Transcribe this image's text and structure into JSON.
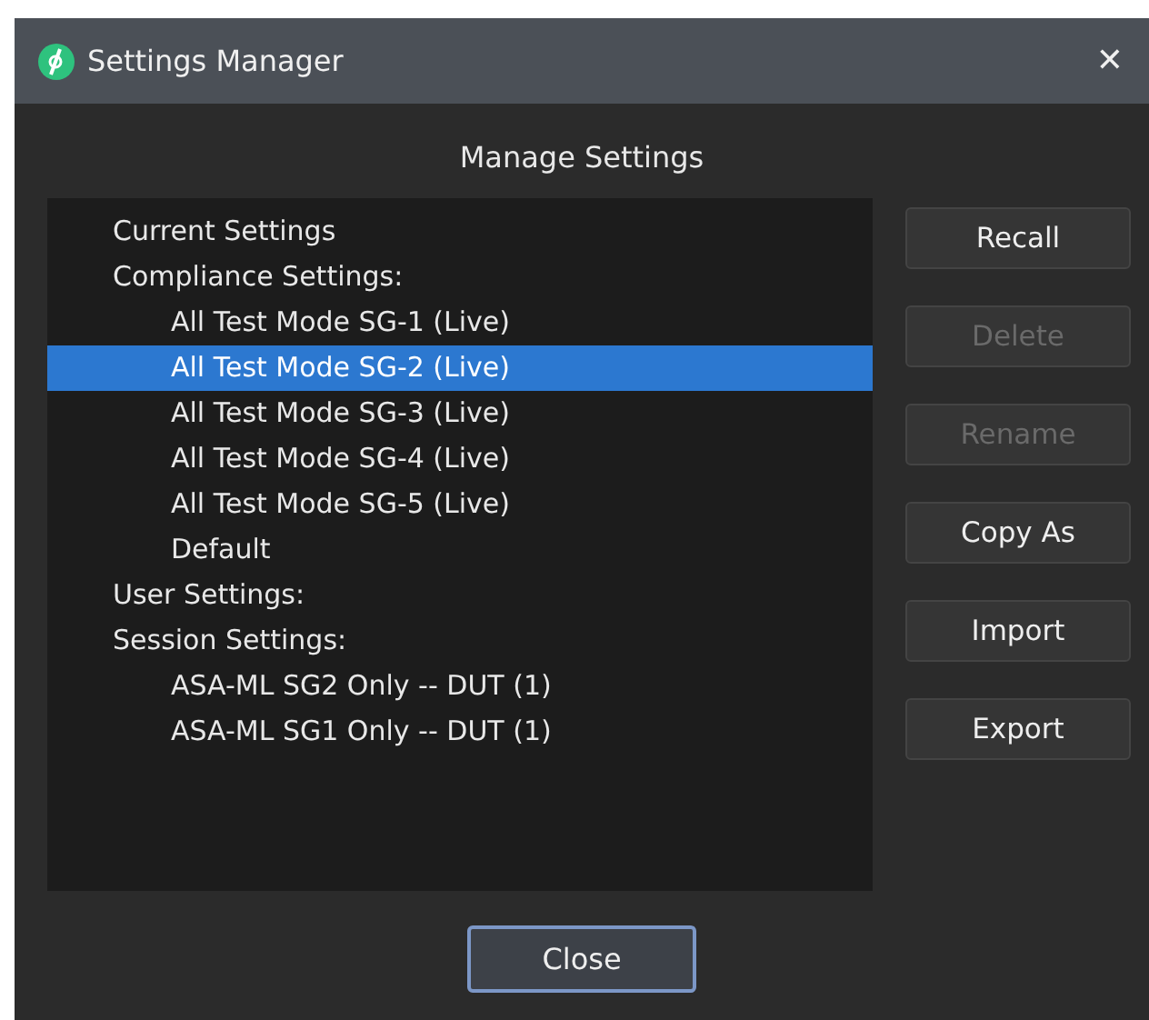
{
  "window": {
    "title": "Settings Manager",
    "close": "✕"
  },
  "heading": "Manage Settings",
  "tree": [
    {
      "label": "Current Settings",
      "selected": false
    },
    {
      "label": "Compliance Settings:",
      "selected": false,
      "children": [
        {
          "label": "All Test Mode SG-1 (Live)",
          "selected": false
        },
        {
          "label": "All Test Mode SG-2 (Live)",
          "selected": true
        },
        {
          "label": "All Test Mode SG-3 (Live)",
          "selected": false
        },
        {
          "label": "All Test Mode SG-4 (Live)",
          "selected": false
        },
        {
          "label": "All Test Mode SG-5 (Live)",
          "selected": false
        },
        {
          "label": "Default",
          "selected": false
        }
      ]
    },
    {
      "label": "User Settings:",
      "selected": false
    },
    {
      "label": "Session Settings:",
      "selected": false,
      "children": [
        {
          "label": "ASA-ML SG2 Only -- DUT (1)",
          "selected": false
        },
        {
          "label": "ASA-ML SG1 Only -- DUT (1)",
          "selected": false
        }
      ]
    }
  ],
  "buttons": [
    {
      "label": "Recall",
      "disabled": false
    },
    {
      "label": "Delete",
      "disabled": true
    },
    {
      "label": "Rename",
      "disabled": true
    },
    {
      "label": "Copy As",
      "disabled": false
    },
    {
      "label": "Import",
      "disabled": false
    },
    {
      "label": "Export",
      "disabled": false
    }
  ],
  "close_button": "Close"
}
